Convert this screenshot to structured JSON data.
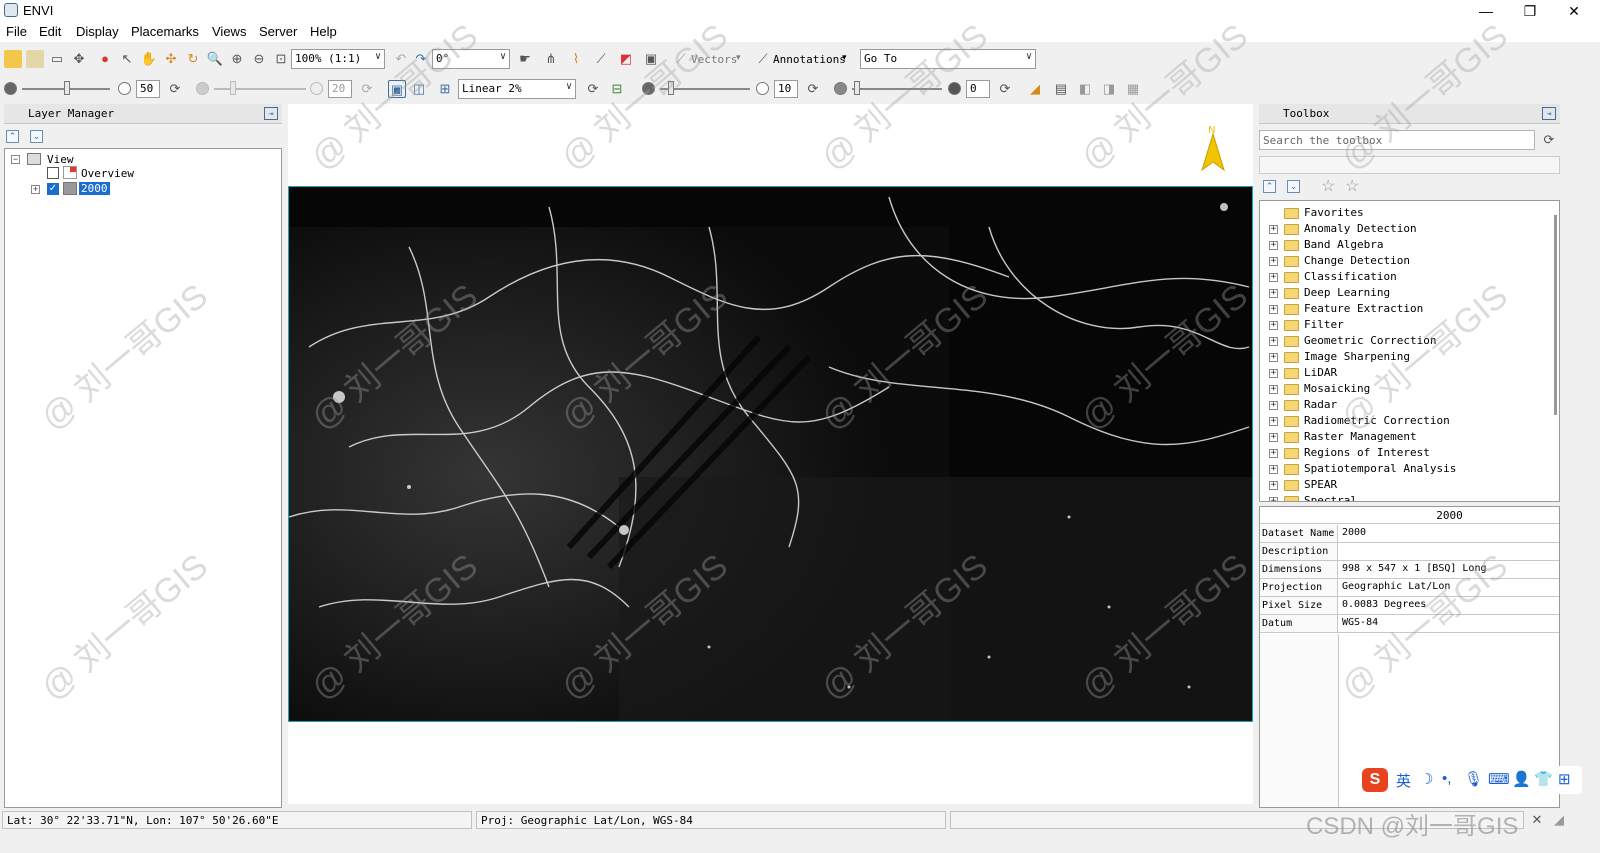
{
  "window": {
    "title": "ENVI",
    "minimize": "—",
    "restore": "❐",
    "close": "✕"
  },
  "menu": [
    "File",
    "Edit",
    "Display",
    "Placemarks",
    "Views",
    "Server",
    "Help"
  ],
  "toolbar1": {
    "zoom_value": "100% (1:1)",
    "rotation_value": "0°",
    "vectors_label": "Vectors",
    "annotations_label": "Annotations",
    "goto_value": "Go To"
  },
  "toolbar2": {
    "brightness_value": "50",
    "contrast_value": "20",
    "stretch_value": "Linear 2%",
    "sharpen_value": "10",
    "transparency_value": "0"
  },
  "layer_manager": {
    "title": "Layer Manager",
    "view_label": "View",
    "overview_label": "Overview",
    "layer_label": "2000"
  },
  "view": {
    "north_label": "N"
  },
  "toolbox": {
    "title": "Toolbox",
    "search_placeholder": "Search the toolbox",
    "items": [
      "Favorites",
      "Anomaly Detection",
      "Band Algebra",
      "Change Detection",
      "Classification",
      "Deep Learning",
      "Feature Extraction",
      "Filter",
      "Geometric Correction",
      "Image Sharpening",
      "LiDAR",
      "Mosaicking",
      "Radar",
      "Radiometric Correction",
      "Raster Management",
      "Regions of Interest",
      "Spatiotemporal Analysis",
      "SPEAR",
      "Spectral"
    ]
  },
  "properties": {
    "header": "2000",
    "rows": [
      {
        "key": "Dataset Name",
        "value": "2000"
      },
      {
        "key": "Description",
        "value": ""
      },
      {
        "key": "Dimensions",
        "value": "998 x 547 x 1 [BSQ] Long"
      },
      {
        "key": "Projection",
        "value": "Geographic Lat/Lon"
      },
      {
        "key": "Pixel Size",
        "value": "0.0083 Degrees"
      },
      {
        "key": "Datum",
        "value": "WGS-84"
      }
    ]
  },
  "status": {
    "coords": "Lat: 30° 22'33.71\"N, Lon: 107° 50'26.60\"E",
    "proj": "Proj: Geographic Lat/Lon, WGS-84"
  },
  "ime": {
    "lang": "英",
    "logo": "S"
  },
  "watermark": {
    "text": "@ 刘一哥GIS",
    "corner": "CSDN @刘一哥GIS"
  },
  "colors": {
    "selection": "#1c6dd0",
    "raster_border": "#1aa3b0",
    "north_arrow": "#f2c400"
  }
}
